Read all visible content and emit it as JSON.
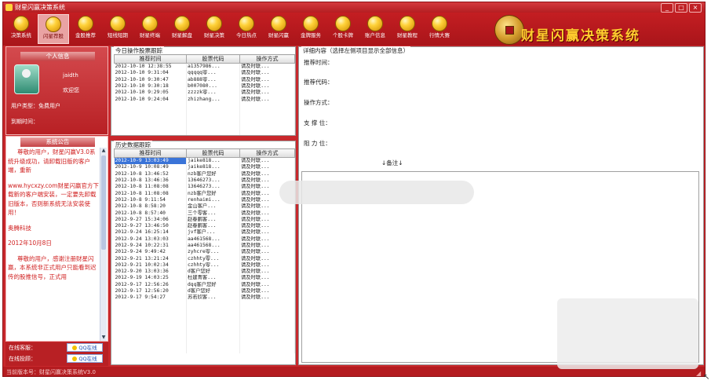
{
  "window": {
    "title": "财星闪赢决策系统",
    "controls": [
      "_",
      "□",
      "×"
    ]
  },
  "toolbar": {
    "items": [
      {
        "label": "决策系统",
        "icon": "coin-icon"
      },
      {
        "label": "闪星荐股",
        "icon": "coin-icon",
        "active": true
      },
      {
        "label": "金股推荐",
        "icon": "coin-icon"
      },
      {
        "label": "短线短期",
        "icon": "coin-icon"
      },
      {
        "label": "财星终端",
        "icon": "coin-icon"
      },
      {
        "label": "财星解盘",
        "icon": "coin-icon"
      },
      {
        "label": "财星决策",
        "icon": "coin-icon"
      },
      {
        "label": "今日热点",
        "icon": "coin-icon"
      },
      {
        "label": "财星闪赢",
        "icon": "coin-icon"
      },
      {
        "label": "金牌服务",
        "icon": "coin-icon"
      },
      {
        "label": "个股卡牌",
        "icon": "coin-icon"
      },
      {
        "label": "账户信息",
        "icon": "coin-icon"
      },
      {
        "label": "财星教程",
        "icon": "coin-icon"
      },
      {
        "label": "行情大赛",
        "icon": "coin-icon"
      }
    ],
    "logo_text": "财星闪赢决策系统"
  },
  "user": {
    "header": "个人信息",
    "name": "jaidth",
    "welcome": "欢迎您",
    "type_label": "用户类型：免费用户",
    "expire_label": "到期时间："
  },
  "announcement": {
    "header": "系统公告",
    "paragraphs": [
      "尊敬的用户，财星闪赢V3.0系统升级成功，请卸载旧版的客户端，重新",
      "www.hycxzy.com财星闪赢官方下载新的客户端安装，一定要先卸载旧版本，否则新系统无法安装使用！",
      "奥腾科技",
      "2012年10月8日",
      "尊敬的用户，感谢注册财星闪赢，本系统非正式用户只能看到迟传的股推信号，正式用"
    ]
  },
  "support": {
    "online_service": "在线客服：",
    "online_service_btn": "QQ在线",
    "online_advisor": "在线投顾：",
    "online_advisor_btn": "QQ在线"
  },
  "today_table": {
    "title": "今日操作股票跟踪",
    "headers": [
      "推荐时间",
      "股票代码",
      "操作方式"
    ],
    "rows": [
      [
        "2012-10-10 12:38:55",
        "a1357986...",
        "请及时联..."
      ],
      [
        "2012-10-10 9:31:04",
        "qqqqq零...",
        "请及时联..."
      ],
      [
        "2012-10-10 9:30:47",
        "ab888零...",
        "请及时联..."
      ],
      [
        "2012-10-10 9:30:18",
        "b007080...",
        "请及时联..."
      ],
      [
        "2012-10-10 9:29:05",
        "zzzzk零...",
        "请及时联..."
      ],
      [
        "2012-10-10 9:24:04",
        "zhizhang...",
        "请及时联..."
      ]
    ]
  },
  "history_table": {
    "title": "历史数据跟踪",
    "headers": [
      "推荐时间",
      "股票代码",
      "操作方式"
    ],
    "rows": [
      [
        "2012-10-9 13:03:49",
        "jaike818...",
        "请及时联..."
      ],
      [
        "2012-10-9 10:08:49",
        "jaike818...",
        "请及时联..."
      ],
      [
        "2012-10-8 13:46:52",
        "nzb客户您好",
        "请及时联..."
      ],
      [
        "2012-10-8 13:46:36",
        "13646273...",
        "请及时联..."
      ],
      [
        "2012-10-8 11:08:08",
        "13646273...",
        "请及时联..."
      ],
      [
        "2012-10-8 11:08:08",
        "nzb客户您好",
        "请及时联..."
      ],
      [
        "2012-10-8 9:11:54",
        "renhaimi...",
        "请及时联..."
      ],
      [
        "2012-10-8 8:58:20",
        "金山客户...",
        "请及时联..."
      ],
      [
        "2012-10-8 8:57:40",
        "三个零客...",
        "请及时联..."
      ],
      [
        "2012-9-27 15:34:06",
        "赵春鹏客...",
        "请及时联..."
      ],
      [
        "2012-9-27 13:46:50",
        "赵春鹏客...",
        "请及时联..."
      ],
      [
        "2012-9-24 16:25:14",
        "jvf客户...",
        "请及时联..."
      ],
      [
        "2012-9-24 13:03:03",
        "aa461568...",
        "请及时联..."
      ],
      [
        "2012-9-24 10:22:31",
        "aa461568...",
        "请及时联..."
      ],
      [
        "2012-9-24 9:49:42",
        "zyhcre零...",
        "请及时联..."
      ],
      [
        "2012-9-21 13:21:24",
        "czhhty零...",
        "请及时联..."
      ],
      [
        "2012-9-21 10:02:34",
        "czhhty零...",
        "请及时联..."
      ],
      [
        "2012-9-20 13:03:36",
        "d客户您好",
        "请及时联..."
      ],
      [
        "2012-9-19 14:03:25",
        "杜建青客...",
        "请及时联..."
      ],
      [
        "2012-9-17 12:56:26",
        "dqq客户您好",
        "请及时联..."
      ],
      [
        "2012-9-17 12:56:20",
        "d客户您好",
        "请及时联..."
      ],
      [
        "2012-9-17 9:54:27",
        "苏若欣客...",
        "请及时联..."
      ]
    ]
  },
  "detail": {
    "title": "详细内容（选择左侧项目显示全部信息）",
    "recommend_time_label": "推荐时间：",
    "stock_code_label": "推荐代码：",
    "operation_label": "操作方式：",
    "support_label": "支 撑 位：",
    "resistance_label": "阻 力 位：",
    "memo_label": "↓备注↓"
  },
  "status": {
    "text": "当前版本号：财星闪赢决策系统V3.0"
  },
  "colors": {
    "frame_red": "#c8282c",
    "selection_blue": "#3a74d8",
    "announcement_text": "#d02020",
    "logo_gold": "#ffcd2e"
  }
}
